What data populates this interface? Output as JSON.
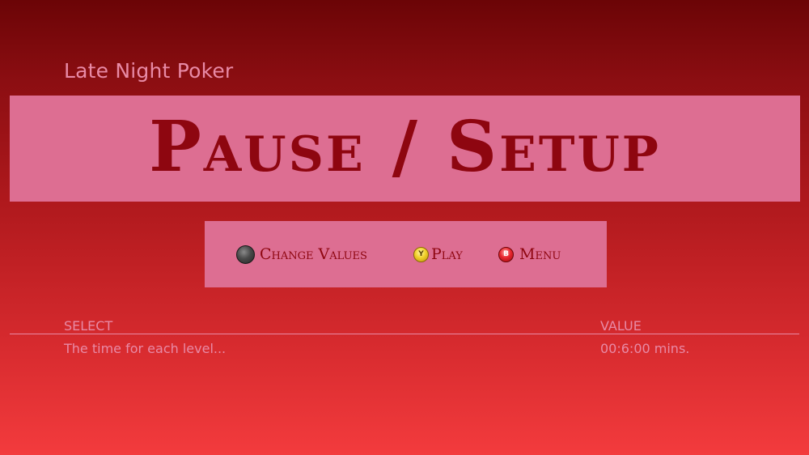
{
  "app_title": "Late Night Poker",
  "banner": {
    "title": "Pause / Setup"
  },
  "controls": {
    "change_values": {
      "label": "Change Values",
      "icon": "left-stick-icon"
    },
    "play": {
      "label": "Play",
      "icon": "y-button-icon",
      "glyph": "Y"
    },
    "menu": {
      "label": "Menu",
      "icon": "b-button-icon",
      "glyph": "B"
    }
  },
  "settings_table": {
    "headers": {
      "select": "SELECT",
      "value": "VALUE"
    },
    "rows": [
      {
        "select": "The time for each level...",
        "value": "00:6:00 mins."
      }
    ]
  },
  "colors": {
    "background_top": "#6b0406",
    "background_bottom": "#f33b3d",
    "panel": "#dd6e92",
    "panel_text": "#8e0610",
    "muted_text": "#e88aa6"
  }
}
